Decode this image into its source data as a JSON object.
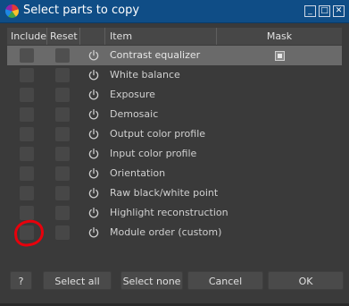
{
  "window": {
    "title": "Select parts to copy",
    "minimize_glyph": "_",
    "maximize_glyph": "□",
    "close_glyph": "✕"
  },
  "table": {
    "headers": {
      "include": "Include",
      "reset": "Reset",
      "item": "Item",
      "mask": "Mask"
    },
    "rows": [
      {
        "label": "Contrast equalizer",
        "selected": true,
        "has_mask": true
      },
      {
        "label": "White balance"
      },
      {
        "label": "Exposure"
      },
      {
        "label": "Demosaic"
      },
      {
        "label": "Output color profile"
      },
      {
        "label": "Input color profile"
      },
      {
        "label": "Orientation"
      },
      {
        "label": "Raw black/white point"
      },
      {
        "label": "Highlight reconstruction"
      },
      {
        "label": "Module order (custom)"
      }
    ]
  },
  "buttons": {
    "help": "?",
    "select_all": "Select all",
    "select_none": "Select none",
    "cancel": "Cancel",
    "ok": "OK"
  },
  "colors": {
    "titlebar": "#0f4d86",
    "background": "#3a3a3a",
    "annotation": "#e8000b"
  }
}
